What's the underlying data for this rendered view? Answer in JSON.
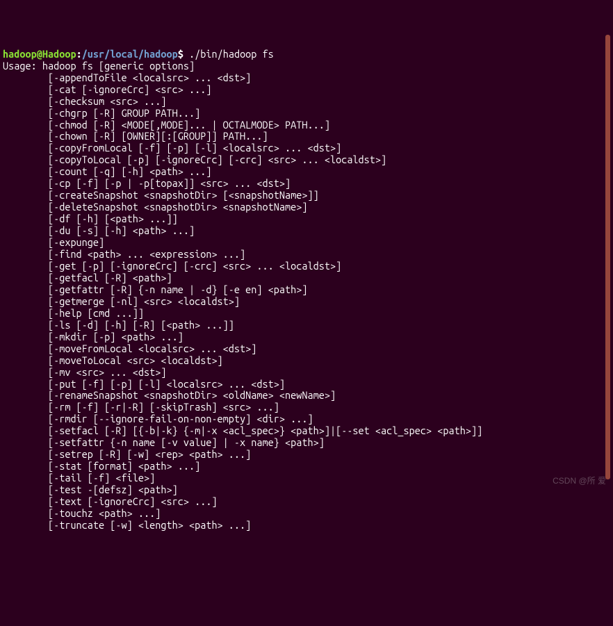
{
  "prompt": {
    "truncated_top": "",
    "user_host": "hadoop@Hadoop",
    "sep1": ":",
    "path": "/usr/local/hadoop",
    "sep2": "$ ",
    "command": "./bin/hadoop fs"
  },
  "usage_line": "Usage: hadoop fs [generic options]",
  "commands": [
    "[-appendToFile <localsrc> ... <dst>]",
    "[-cat [-ignoreCrc] <src> ...]",
    "[-checksum <src> ...]",
    "[-chgrp [-R] GROUP PATH...]",
    "[-chmod [-R] <MODE[,MODE]... | OCTALMODE> PATH...]",
    "[-chown [-R] [OWNER][:[GROUP]] PATH...]",
    "[-copyFromLocal [-f] [-p] [-l] <localsrc> ... <dst>]",
    "[-copyToLocal [-p] [-ignoreCrc] [-crc] <src> ... <localdst>]",
    "[-count [-q] [-h] <path> ...]",
    "[-cp [-f] [-p | -p[topax]] <src> ... <dst>]",
    "[-createSnapshot <snapshotDir> [<snapshotName>]]",
    "[-deleteSnapshot <snapshotDir> <snapshotName>]",
    "[-df [-h] [<path> ...]]",
    "[-du [-s] [-h] <path> ...]",
    "[-expunge]",
    "[-find <path> ... <expression> ...]",
    "[-get [-p] [-ignoreCrc] [-crc] <src> ... <localdst>]",
    "[-getfacl [-R] <path>]",
    "[-getfattr [-R] {-n name | -d} [-e en] <path>]",
    "[-getmerge [-nl] <src> <localdst>]",
    "[-help [cmd ...]]",
    "[-ls [-d] [-h] [-R] [<path> ...]]",
    "[-mkdir [-p] <path> ...]",
    "[-moveFromLocal <localsrc> ... <dst>]",
    "[-moveToLocal <src> <localdst>]",
    "[-mv <src> ... <dst>]",
    "[-put [-f] [-p] [-l] <localsrc> ... <dst>]",
    "[-renameSnapshot <snapshotDir> <oldName> <newName>]",
    "[-rm [-f] [-r|-R] [-skipTrash] <src> ...]",
    "[-rmdir [--ignore-fail-on-non-empty] <dir> ...]",
    "[-setfacl [-R] [{-b|-k} {-m|-x <acl_spec>} <path>]|[--set <acl_spec> <path>]]",
    "[-setfattr {-n name [-v value] | -x name} <path>]",
    "[-setrep [-R] [-w] <rep> <path> ...]",
    "[-stat [format] <path> ...]",
    "[-tail [-f] <file>]",
    "[-test -[defsz] <path>]",
    "[-text [-ignoreCrc] <src> ...]",
    "[-touchz <path> ...]",
    "[-truncate [-w] <length> <path> ...]"
  ],
  "indent": "        ",
  "watermark": "CSDN @所 爱"
}
